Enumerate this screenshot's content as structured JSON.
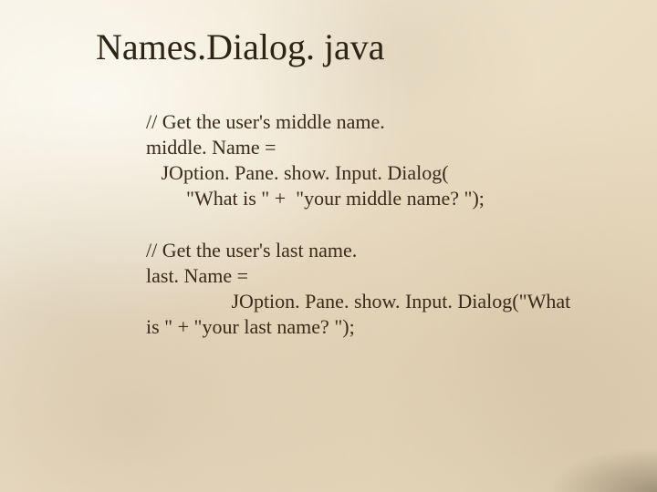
{
  "title": "Names.Dialog. java",
  "code": {
    "block1": {
      "l1": "// Get the user's middle name.",
      "l2": "middle. Name =",
      "l3": "   JOption. Pane. show. Input. Dialog(",
      "l4": "        \"What is \" +  \"your middle name? \");"
    },
    "block2": {
      "l1": "// Get the user's last name.",
      "l2": "last. Name =",
      "l3": "                 JOption. Pane. show. Input. Dialog(\"What",
      "l4": "is \" + \"your last name? \");"
    }
  }
}
